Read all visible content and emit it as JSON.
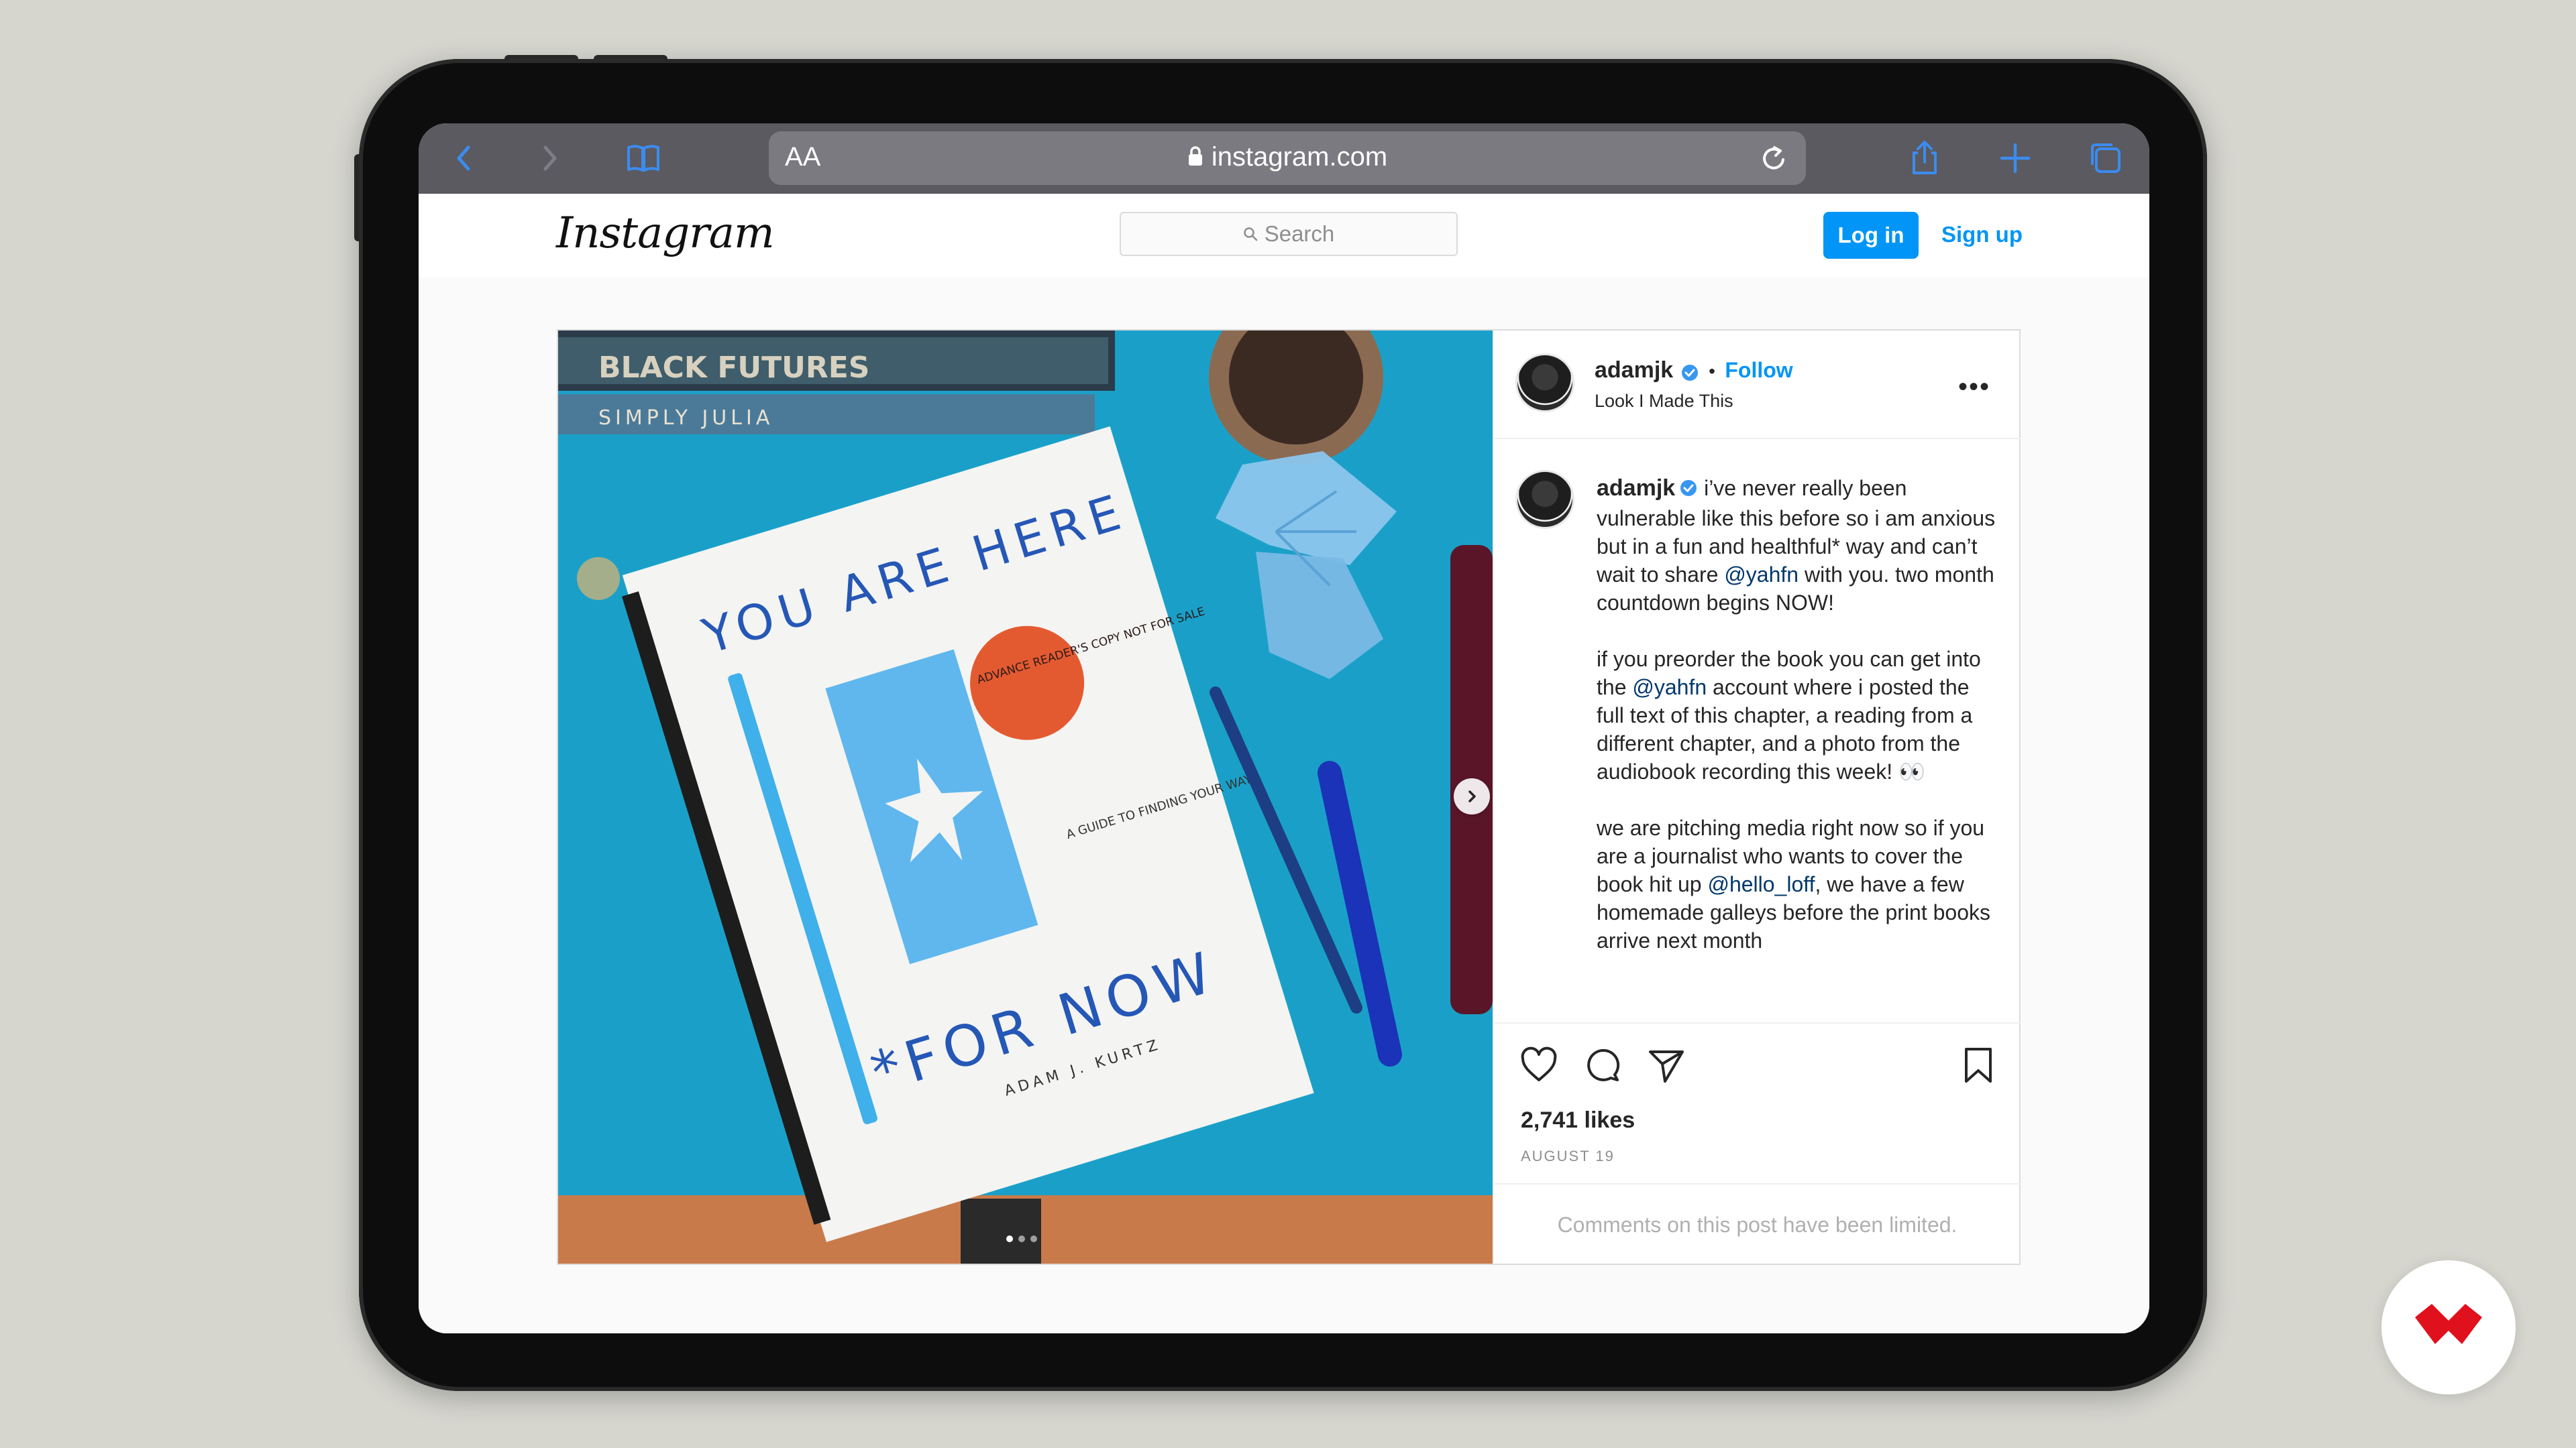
{
  "browser": {
    "address": {
      "text_size_label": "AA",
      "url": "instagram.com"
    },
    "icons": {
      "back": "chevron-left-icon",
      "forward": "chevron-right-icon",
      "bookmarks": "book-icon",
      "reload": "reload-icon",
      "share": "share-icon",
      "new_tab": "plus-icon",
      "tabs": "tabs-icon"
    }
  },
  "header": {
    "logo_text": "Instagram",
    "search_placeholder": "Search",
    "login_label": "Log in",
    "signup_label": "Sign up"
  },
  "post": {
    "author": {
      "username": "adamjk",
      "verified": true,
      "follow_label": "Follow",
      "separator": "•"
    },
    "location": "Look I Made This",
    "caption": {
      "username": "adamjk",
      "segments": [
        {
          "type": "text",
          "text": " i’ve never really been vulnerable like this before so i am anxious but in a fun and healthful* way and can’t wait to share "
        },
        {
          "type": "mention",
          "text": "@yahfn"
        },
        {
          "type": "text",
          "text": " with you. two month countdown begins NOW!\n\nif you preorder the book you can get into the "
        },
        {
          "type": "mention",
          "text": "@yahfn"
        },
        {
          "type": "text",
          "text": " account where i posted the full text of this chapter, a reading from a different chapter, and a photo from the audiobook recording this week! 👀\n\nwe are pitching media right now so if you are a journalist who wants to cover the book hit up "
        },
        {
          "type": "mention",
          "text": "@hello_loff"
        },
        {
          "type": "text",
          "text": ", we have a few homemade galleys before the print books arrive next month"
        }
      ]
    },
    "likes_label": "2,741 likes",
    "date_label": "AUGUST 19",
    "comments_notice": "Comments on this post have been limited.",
    "carousel": {
      "count": 3,
      "active_index": 0
    },
    "photo_text": {
      "title_line1": "YOU ARE HERE",
      "title_line2": "*FOR NOW",
      "author": "ADAM J. KURTZ",
      "subtitle": "A GUIDE TO FINDING YOUR WAY",
      "sticker": "ADVANCE READER'S COPY NOT FOR SALE",
      "book_spine_1": "BLACK FUTURES",
      "book_spine_2": "SIMPLY JULIA"
    }
  },
  "colors": {
    "safari_toolbar": "#5a5a60",
    "ig_blue": "#0095f6",
    "mention_blue": "#00376b",
    "desk_blue": "#1f9fc5",
    "brand_red": "#e0101c"
  }
}
